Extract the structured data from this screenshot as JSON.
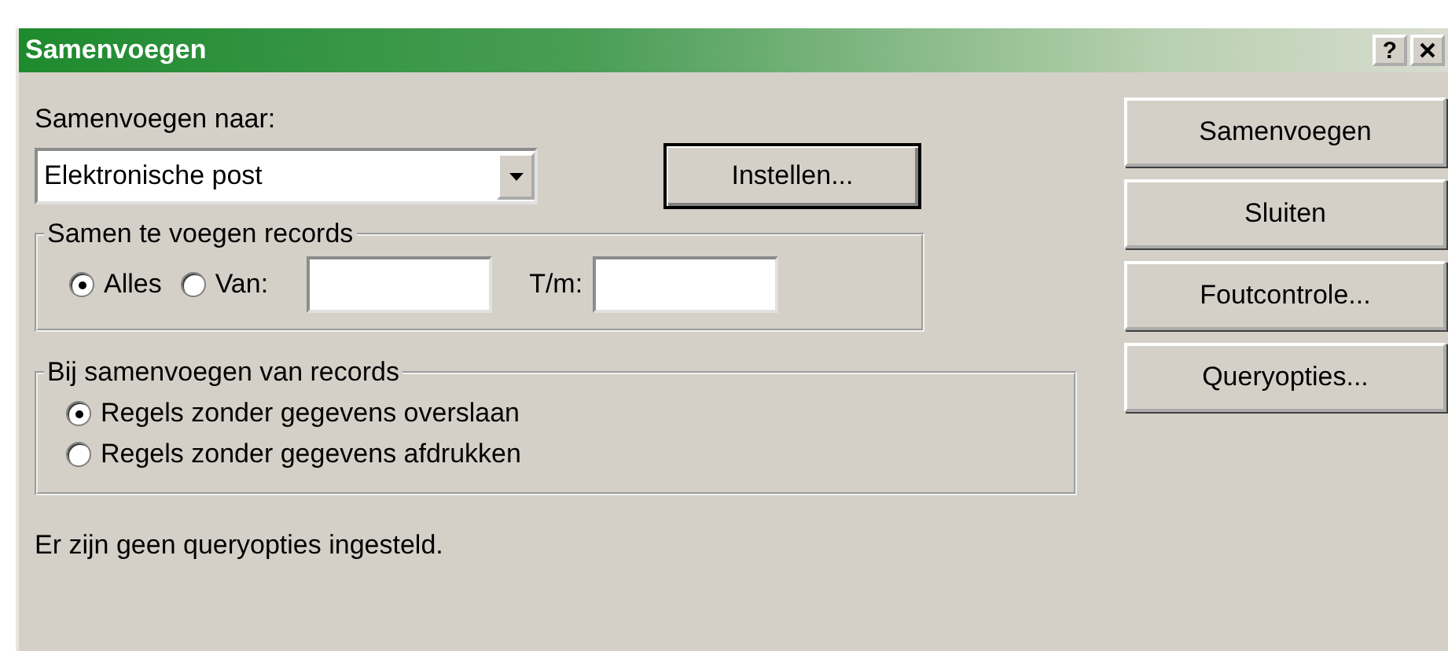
{
  "window": {
    "title": "Samenvoegen",
    "help_button": "?"
  },
  "merge_to": {
    "label": "Samenvoegen naar:",
    "value": "Elektronische post"
  },
  "setup_button": "Instellen...",
  "records_group": {
    "title": "Samen te voegen records",
    "options": [
      {
        "label": "Alles",
        "selected": true
      },
      {
        "label": "Van:",
        "selected": false
      }
    ],
    "to_label": "T/m:"
  },
  "blank_lines_group": {
    "title": "Bij samenvoegen van records",
    "options": [
      {
        "label": "Regels zonder gegevens overslaan",
        "selected": true
      },
      {
        "label": "Regels zonder gegevens afdrukken",
        "selected": false
      }
    ]
  },
  "status": "Er zijn geen queryopties ingesteld.",
  "buttons": [
    {
      "label": "Samenvoegen"
    },
    {
      "label": "Sluiten"
    },
    {
      "label": "Foutcontrole..."
    },
    {
      "label": "Queryopties..."
    }
  ]
}
